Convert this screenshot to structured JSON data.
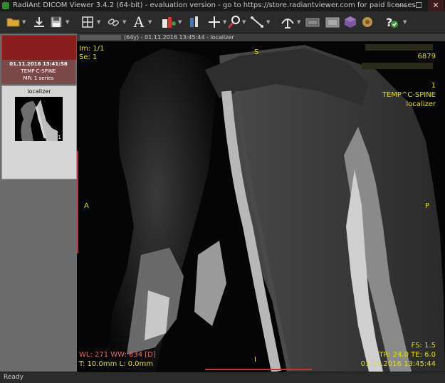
{
  "window": {
    "title": "RadiAnt DICOM Viewer 3.4.2 (64-bit) - evaluation version - go to https://store.radiantviewer.com for paid licenses",
    "buttons": {
      "minimize": "—",
      "maximize": "☐",
      "close": "✕"
    }
  },
  "toolbar": {
    "tools": [
      {
        "name": "open-folder-icon"
      },
      {
        "name": "download-icon"
      },
      {
        "name": "save-icon"
      },
      {
        "name": "layout-grid-icon"
      },
      {
        "name": "link-icon"
      },
      {
        "name": "annotation-text-icon"
      },
      {
        "name": "window-level-icon"
      },
      {
        "name": "crosshair-icon"
      },
      {
        "name": "zoom-icon"
      },
      {
        "name": "measure-line-icon"
      },
      {
        "name": "mpr-icon"
      },
      {
        "name": "screenshot-icon"
      },
      {
        "name": "3d-icon"
      },
      {
        "name": "color-map-icon"
      },
      {
        "name": "circle-icon"
      },
      {
        "name": "help-icon"
      }
    ],
    "text_tool_glyph": "A"
  },
  "sidebar": {
    "study": {
      "date": "01.11.2016 13:41:58",
      "description": "TEMP C-SPINE",
      "series_count": "MR: 1 series"
    },
    "series": [
      {
        "label": "localizer",
        "count": "1"
      }
    ]
  },
  "viewport_header": {
    "age": "(64y)",
    "info": "- 01.11.2016 13:45:44 - localizer"
  },
  "overlay": {
    "image_index": "Im: 1/1",
    "series_index": "Se: 1",
    "orient_top": "S",
    "orient_left": "A",
    "orient_right": "P",
    "orient_bottom": "I",
    "patient_id": "6879",
    "series_number": "1",
    "study_desc": "TEMP^C-SPINE",
    "series_desc": "localizer",
    "wl_ww": "WL: 271 WW: 634 [D]",
    "thickness_loc": "T: 10.0mm L: 0.0mm",
    "field_strength": "FS: 1.5",
    "tr_te": "TR: 24.0 TE: 6.0",
    "datetime": "01.11.2016 13:45:44"
  },
  "status": {
    "text": "Ready"
  },
  "colors": {
    "overlay_text": "#e6e000",
    "wl_text": "#e06a6a",
    "study_header": "#8a1e1e",
    "ruler": "#c83232"
  }
}
